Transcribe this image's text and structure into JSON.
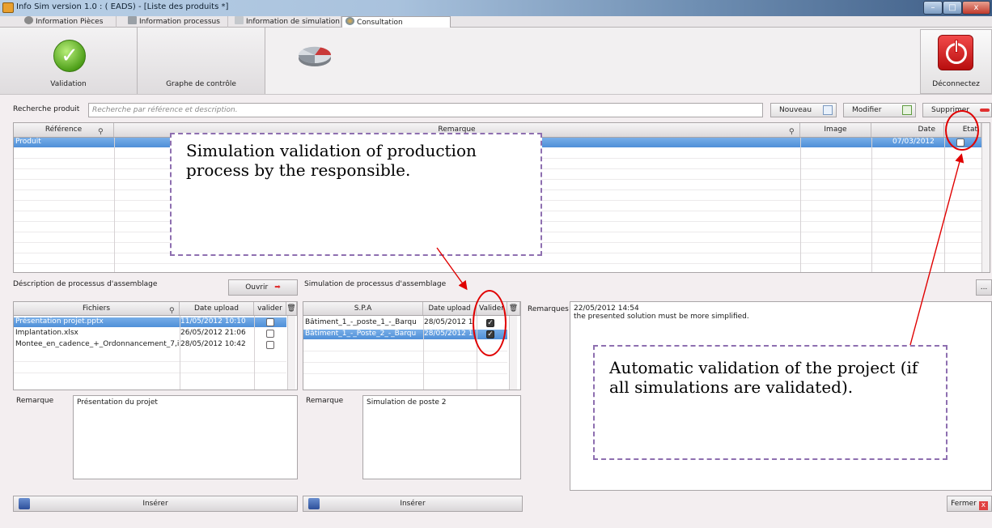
{
  "window": {
    "title": "Info Sim version 1.0 :  ( EADS) - [Liste des produits *]",
    "min_glyph": "–",
    "max_glyph": "□",
    "close_glyph": "x"
  },
  "tabs": [
    {
      "label": "Information Pièces"
    },
    {
      "label": "Information processus"
    },
    {
      "label": "Information de simulation"
    },
    {
      "label": "Consultation"
    }
  ],
  "ribbon": {
    "validation_label": "Validation",
    "graph_label": "Graphe de contrôle",
    "disconnect_label": "Déconnectez"
  },
  "search": {
    "label": "Recherche produit",
    "placeholder": "Recherche par référence et description.",
    "new_label": "Nouveau",
    "modify_label": "Modifier",
    "delete_label": "Supprimer"
  },
  "products": {
    "columns": [
      "Référence",
      "Remarque",
      "Image",
      "Date",
      "Etat"
    ],
    "rows": [
      {
        "reference": "Produit",
        "remarque": "",
        "image": "",
        "date": "07/03/2012",
        "etat": false
      }
    ]
  },
  "assembly": {
    "title": "Déscription de processus d'assemblage",
    "open_label": "Ouvrir",
    "columns": [
      "Fichiers",
      "Date upload",
      "valider"
    ],
    "rows": [
      {
        "file": "Présentation projet.pptx",
        "date": "11/05/2012 10:10"
      },
      {
        "file": "Implantation.xlsx",
        "date": "26/05/2012 21:06"
      },
      {
        "file": "Montee_en_cadence_+_Ordonnancement_7,i",
        "date": "28/05/2012 10:42"
      }
    ],
    "remark_label": "Remarque",
    "remark_text": "Présentation du projet",
    "insert_label": "Insérer"
  },
  "simulation": {
    "title": "Simulation de processus d'assemblage",
    "columns": [
      "S.P.A",
      "Date upload",
      "Valider"
    ],
    "rows": [
      {
        "spa": "Bâtiment_1_-_poste_1_-_Barqu",
        "date": "28/05/2012 1"
      },
      {
        "spa": "Bâtiment_1_-_Poste_2_-_Barqu",
        "date": "28/05/2012 1"
      }
    ],
    "remark_label": "Remarque",
    "remark_text": "Simulation de poste 2",
    "insert_label": "Insérer"
  },
  "remarks": {
    "label": "Remarques",
    "timestamp": "22/05/2012 14:54",
    "text": "the presented solution must be more simplified.",
    "more_label": "...",
    "close_label": "Fermer"
  },
  "annotations": {
    "left_callout": "Simulation validation of production process by the responsible.",
    "right_callout": " Automatic validation of the project (if all simulations are validated)."
  },
  "colors": {
    "selection": "#4f8fd8",
    "annotation_arrow": "#e00000",
    "callout_border": "#8e6fb0"
  }
}
